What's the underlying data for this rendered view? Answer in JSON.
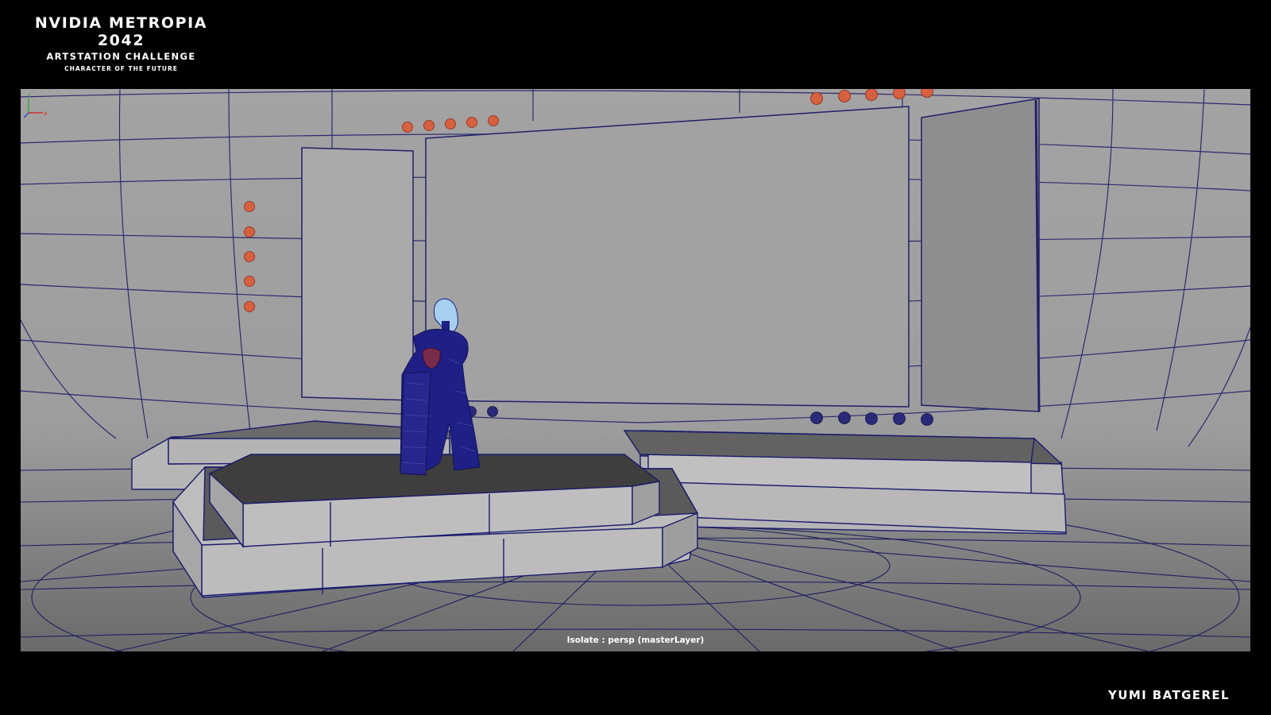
{
  "header": {
    "title": "NVIDIA METROPIA 2042",
    "subtitle": "ARTSTATION CHALLENGE",
    "tagline": "CHARACTER OF THE FUTURE"
  },
  "viewport": {
    "label": "Isolate : persp (masterLayer)",
    "camera": "persp",
    "icons": {
      "axis": "axis-gizmo-icon"
    },
    "axis_labels": {
      "y": "y",
      "x": "x"
    },
    "colors": {
      "wireframe": "#1a1a6e",
      "spotlight_light": "#d9603e",
      "spotlight_dark": "#2a2a7a",
      "character": "#1f1f88",
      "hair": "#a6cff0"
    }
  },
  "footer": {
    "artist_name": "YUMI BATGEREL"
  }
}
